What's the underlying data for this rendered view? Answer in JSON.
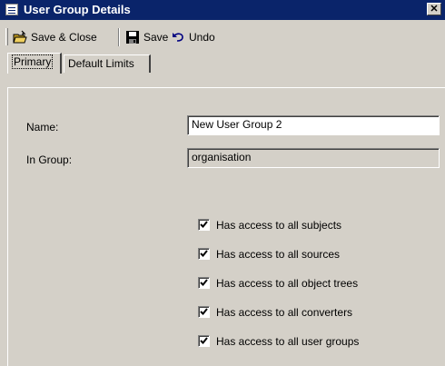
{
  "window": {
    "title": "User Group Details",
    "close_glyph": "✕"
  },
  "toolbar": {
    "save_close_label": "Save & Close",
    "save_label": "Save",
    "undo_label": "Undo"
  },
  "tabs": [
    {
      "label": "Primary",
      "active": true
    },
    {
      "label": "Default Limits",
      "active": false
    }
  ],
  "form": {
    "name_label": "Name:",
    "name_value": "New User Group 2",
    "in_group_label": "In Group:",
    "in_group_value": "organisation"
  },
  "checkboxes": [
    {
      "label": "Has access to all subjects",
      "checked": true
    },
    {
      "label": "Has access to all sources",
      "checked": true
    },
    {
      "label": "Has access to all object trees",
      "checked": true
    },
    {
      "label": "Has access to all converters",
      "checked": true
    },
    {
      "label": "Has access to all user groups",
      "checked": true
    }
  ],
  "colors": {
    "titlebar": "#0a246a",
    "face": "#d4d0c8"
  }
}
